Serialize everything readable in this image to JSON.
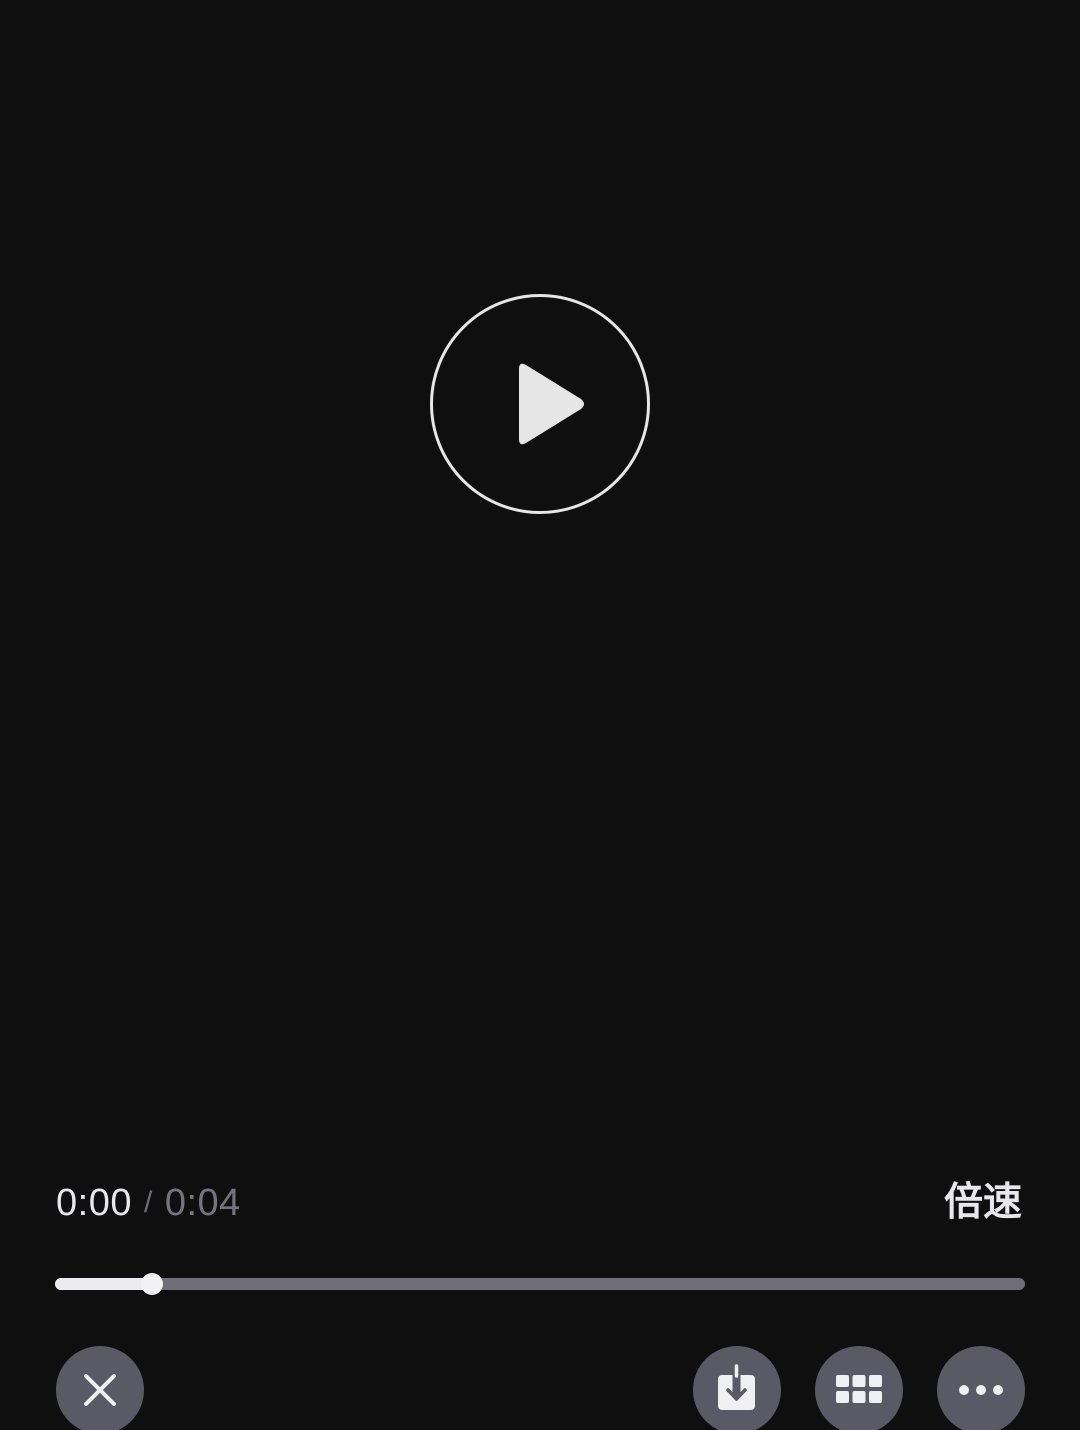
{
  "player": {
    "state": "paused",
    "center_icon": "play-icon"
  },
  "time": {
    "current": "0:00",
    "separator": "/",
    "total": "0:04"
  },
  "speed": {
    "label": "倍速"
  },
  "progress": {
    "fraction": 0.1
  },
  "bottom_bar": {
    "buttons": [
      {
        "icon": "close-icon"
      },
      {
        "icon": "download-icon"
      },
      {
        "icon": "grid-icon"
      },
      {
        "icon": "more-icon"
      }
    ]
  },
  "colors": {
    "background": "#0f0f10",
    "button_bg": "#5a5a66",
    "progress_track": "#6e6e78",
    "progress_fill": "#ececf0",
    "text_primary": "#e8e8ec",
    "text_secondary": "#74747c"
  }
}
